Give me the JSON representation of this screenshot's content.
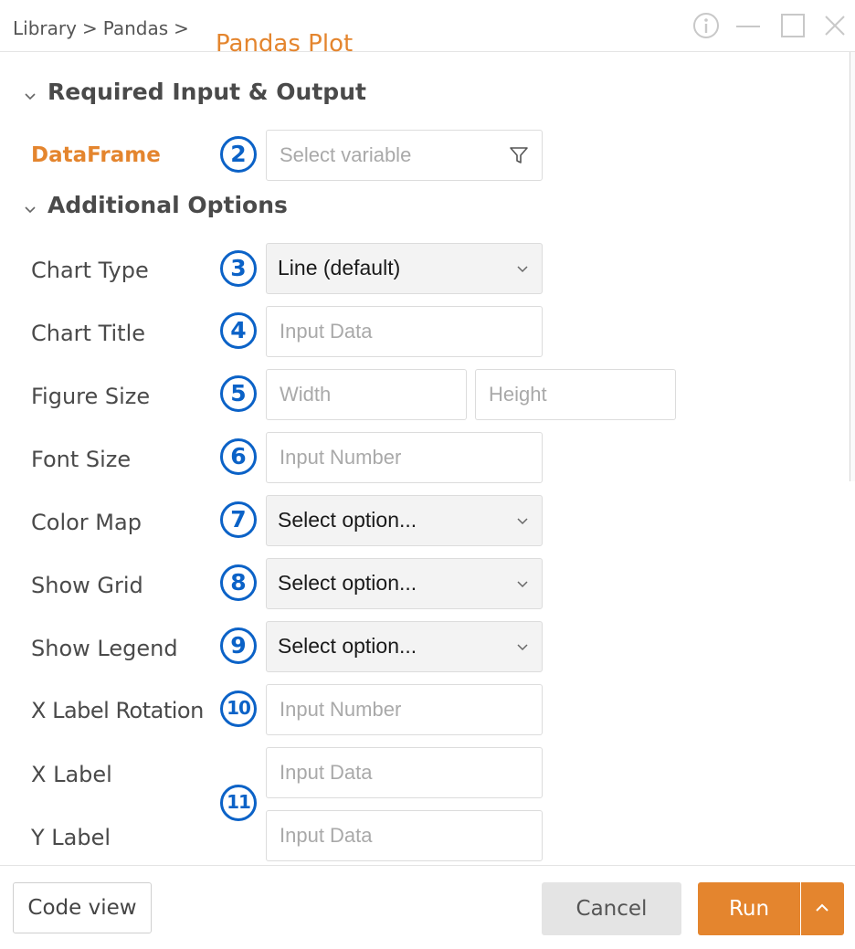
{
  "breadcrumb": {
    "items": [
      "Library",
      "Pandas"
    ],
    "separator": ">",
    "current": "Pandas Plot"
  },
  "window_controls": [
    "info-icon",
    "minimize-icon",
    "maximize-icon",
    "close-icon"
  ],
  "sections": {
    "required": "Required Input & Output",
    "additional": "Additional Options"
  },
  "fields": {
    "dataframe": {
      "label": "DataFrame",
      "marker": "2",
      "placeholder": "Select variable",
      "icon": "filter-icon"
    },
    "chart_type": {
      "label": "Chart Type",
      "marker": "3",
      "value": "Line (default)"
    },
    "chart_title": {
      "label": "Chart Title",
      "marker": "4",
      "placeholder": "Input Data"
    },
    "figure_size": {
      "label": "Figure Size",
      "marker": "5",
      "width_placeholder": "Width",
      "height_placeholder": "Height"
    },
    "font_size": {
      "label": "Font Size",
      "marker": "6",
      "placeholder": "Input Number"
    },
    "color_map": {
      "label": "Color Map",
      "marker": "7",
      "value": "Select option..."
    },
    "show_grid": {
      "label": "Show Grid",
      "marker": "8",
      "value": "Select option..."
    },
    "show_legend": {
      "label": "Show Legend",
      "marker": "9",
      "value": "Select option..."
    },
    "x_label_rotation": {
      "label": "X Label Rotation",
      "marker": "10",
      "placeholder": "Input Number"
    },
    "x_label": {
      "label": "X Label",
      "placeholder": "Input Data"
    },
    "y_label": {
      "label": "Y Label",
      "placeholder": "Input Data"
    },
    "labels_marker": "11"
  },
  "footer": {
    "code_view": "Code view",
    "cancel": "Cancel",
    "run": "Run"
  },
  "colors": {
    "accent": "#e4852e",
    "marker": "#0b62c7",
    "select_bg": "#f3f3f3"
  }
}
